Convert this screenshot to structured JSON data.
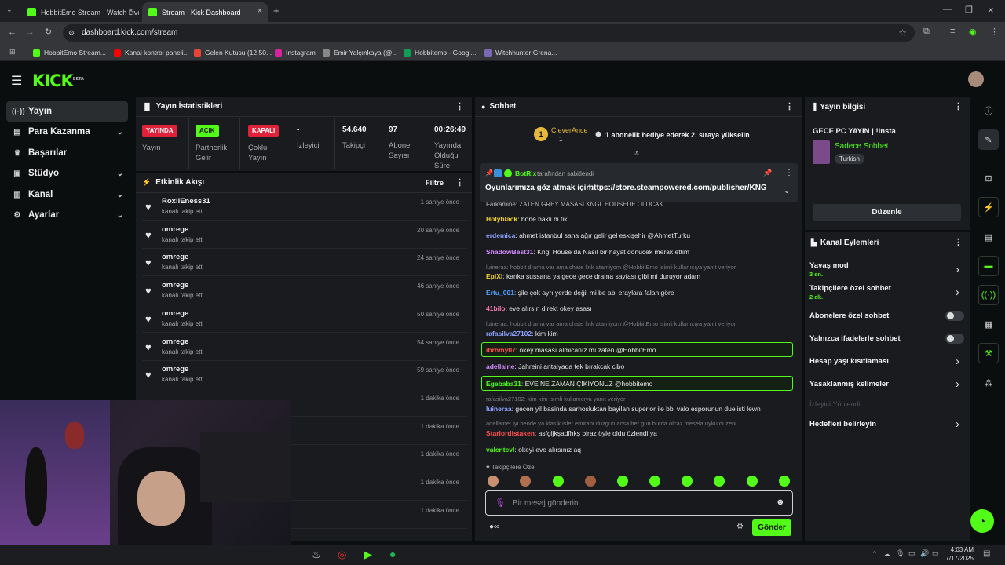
{
  "browser": {
    "tabs": [
      {
        "label": "HobbitEmo Stream - Watch Live"
      },
      {
        "label": "Stream - Kick Dashboard"
      }
    ],
    "url": "dashboard.kick.com/stream",
    "bookmarks": [
      "HobbitEmo Stream...",
      "Kanal kontrol paneli...",
      "Gelen Kutusu (12.50...",
      "Instagram",
      "Emir Yalçınkaya (@...",
      "Hobbitemo - Googl...",
      "Witchhunter Grena..."
    ]
  },
  "brand": {
    "logo": "KICK",
    "beta": "BETA",
    "accent": "#53fc18"
  },
  "sidebar": {
    "items": [
      {
        "label": "Yayın",
        "icon": "live-icon",
        "active": true
      },
      {
        "label": "Para Kazanma",
        "icon": "money-icon"
      },
      {
        "label": "Başarılar",
        "icon": "trophy-icon"
      },
      {
        "label": "Stüdyo",
        "icon": "studio-icon"
      },
      {
        "label": "Kanal",
        "icon": "channel-icon"
      },
      {
        "label": "Ayarlar",
        "icon": "gear-icon"
      }
    ]
  },
  "stats": {
    "title": "Yayın İstatistikleri",
    "cells": [
      {
        "badge": "YAYINDA",
        "label": "Yayın"
      },
      {
        "badge": "AÇIK",
        "label": "Partnerlik Gelir"
      },
      {
        "badge": "KAPALI",
        "label": "Çoklu Yayın"
      },
      {
        "value": "-",
        "label": "İzleyici"
      },
      {
        "value": "54.640",
        "label": "Takipçi"
      },
      {
        "value": "97",
        "label": "Abone Sayısı"
      },
      {
        "value": "00:26:49",
        "label": "Yayında Olduğu Süre"
      }
    ]
  },
  "activity": {
    "title": "Etkinlik Akışı",
    "filter": "Filtre",
    "items": [
      {
        "user": "RoxiiEness31",
        "action": "kanalı takip etti",
        "time": "1 saniye önce"
      },
      {
        "user": "omrege",
        "action": "kanalı takip etti",
        "time": "20 saniye önce"
      },
      {
        "user": "omrege",
        "action": "kanalı takip etti",
        "time": "24 saniye önce"
      },
      {
        "user": "omrege",
        "action": "kanalı takip etti",
        "time": "46 saniye önce"
      },
      {
        "user": "omrege",
        "action": "kanalı takip etti",
        "time": "50 saniye önce"
      },
      {
        "user": "omrege",
        "action": "kanalı takip etti",
        "time": "54 saniye önce"
      },
      {
        "user": "omrege",
        "action": "kanalı takip etti",
        "time": "59 saniye önce"
      },
      {
        "user": "",
        "action": "",
        "time": "1 dakika önce"
      },
      {
        "user": "",
        "action": "",
        "time": "1 dakika önce"
      },
      {
        "user": "",
        "action": "",
        "time": "1 dakika önce"
      },
      {
        "user": "",
        "action": "",
        "time": "1 dakika önce"
      },
      {
        "user": "",
        "action": "",
        "time": "1 dakika önce"
      }
    ]
  },
  "chat": {
    "title": "Sohbet",
    "sub_gift": {
      "user": "CleverAnce",
      "count": "1",
      "rank": "1",
      "text": "1 abonelik hediye ederek 2. sıraya yükselin"
    },
    "pinned": {
      "user": "BotRix",
      "by": "tarafından sabitlendi",
      "text": "Oyunlarımıza göz atmak için:",
      "link": "https://store.steampowered.com/publisher/KNGL"
    },
    "partial": "Farkamine: ZATEN GREY MASASI KNGL HOUSEDE OLUCAK",
    "messages": [
      {
        "user": "Holyblack",
        "color": "#f0d21e",
        "text": "bone hakli bi tik"
      },
      {
        "user": "erdemica",
        "color": "#8ea2ff",
        "text": "ahmet istanbul sana ağır gelir gel eskişehir @AhmetTurku"
      },
      {
        "user": "ShadowBest31",
        "color": "#d88bff",
        "text": "Kngl House da Nasıl bir hayat dönücek merak ettim"
      },
      {
        "reply": "luinerаа: hobbit drama var ama chate link atamiyom @HobbitEmo isimli kullanıcıya yanıt veriyor",
        "user": "EpiXi",
        "color": "#f0d21e",
        "text": "kanka sussana ya gece gece drama sayfası gibi mi duruyor adam"
      },
      {
        "user": "Ertu_001",
        "color": "#4da3ff",
        "text": "şile çok ayrı yerde değil mi be abi eraylara falan göre"
      },
      {
        "user": "41bilo",
        "color": "#ff7ab8",
        "text": "eve alırsın direkt okey asası"
      },
      {
        "reply": "luinerаа: hobbit drama var ama chate link atamiyom @HobbitEmo isimli kullanıcıya yanıt veriyor",
        "user": "rafasilva27102",
        "color": "#8ea2ff",
        "text": "kim kim"
      },
      {
        "user": "ibrhmy07",
        "color": "#ff5050",
        "text": "okey masası almicanız mı zaten @HobbitEmo",
        "highlight": true
      },
      {
        "user": "adellaine",
        "color": "#d88bff",
        "text": "Jahreini antalyada tek bırakcak cibo"
      },
      {
        "user": "Egebaba31",
        "color": "#53fc18",
        "text": "EVE NE ZAMAN ÇIKIYONUZ @hobbitemo",
        "highlight": true
      },
      {
        "reply": "rafasilva27102: kim kim isimli kullanıcıya yanıt veriyor",
        "user": "luineraa",
        "color": "#8ea2ff",
        "text": "gecen yil basinda sarhosluktan bayilan superior ile bbl valo esporunun duelisti lewn"
      },
      {
        "reply": "adellaine: iyi bende ya klasik isler emirabi duzgun acsa her gun burda olcaz mesela uyku duzeni...",
        "user": "Starlordistaken",
        "color": "#ff5050",
        "text": "asfgljkşadfhkş biraz öyle oldu özlendi ya"
      },
      {
        "user": "valentevl",
        "color": "#53fc18",
        "text": "okeyi eve alırsınız aq"
      }
    ],
    "followers_only": "Takipçilere Özel",
    "placeholder": "Bir mesaj gönderin",
    "send": "Gönder"
  },
  "stream_info": {
    "title": "Yayın bilgisi",
    "stream_title": "GECE PC YAYIN | !insta",
    "category": "Sadece Sohbet",
    "tag": "Turkish",
    "edit": "Düzenle"
  },
  "channel_actions": {
    "title": "Kanal Eylemleri",
    "items": [
      {
        "label": "Yavaş mod",
        "sub": "3 sn.",
        "type": "chevron"
      },
      {
        "label": "Takipçilere özel sohbet",
        "sub": "2 dk.",
        "type": "chevron"
      },
      {
        "label": "Abonelere özel sohbet",
        "type": "toggle"
      },
      {
        "label": "Yalnızca ifadelerle sohbet",
        "type": "toggle"
      },
      {
        "label": "Hesap yaşı kısıtlaması",
        "type": "chevron"
      },
      {
        "label": "Yasaklanmış kelimeler",
        "type": "chevron"
      },
      {
        "label": "İzleyici Yönlendir",
        "type": "disabled"
      },
      {
        "label": "Hedefleri belirleyin",
        "type": "chevron"
      }
    ]
  },
  "taskbar": {
    "time": "4:03 AM",
    "date": "7/17/2025"
  }
}
